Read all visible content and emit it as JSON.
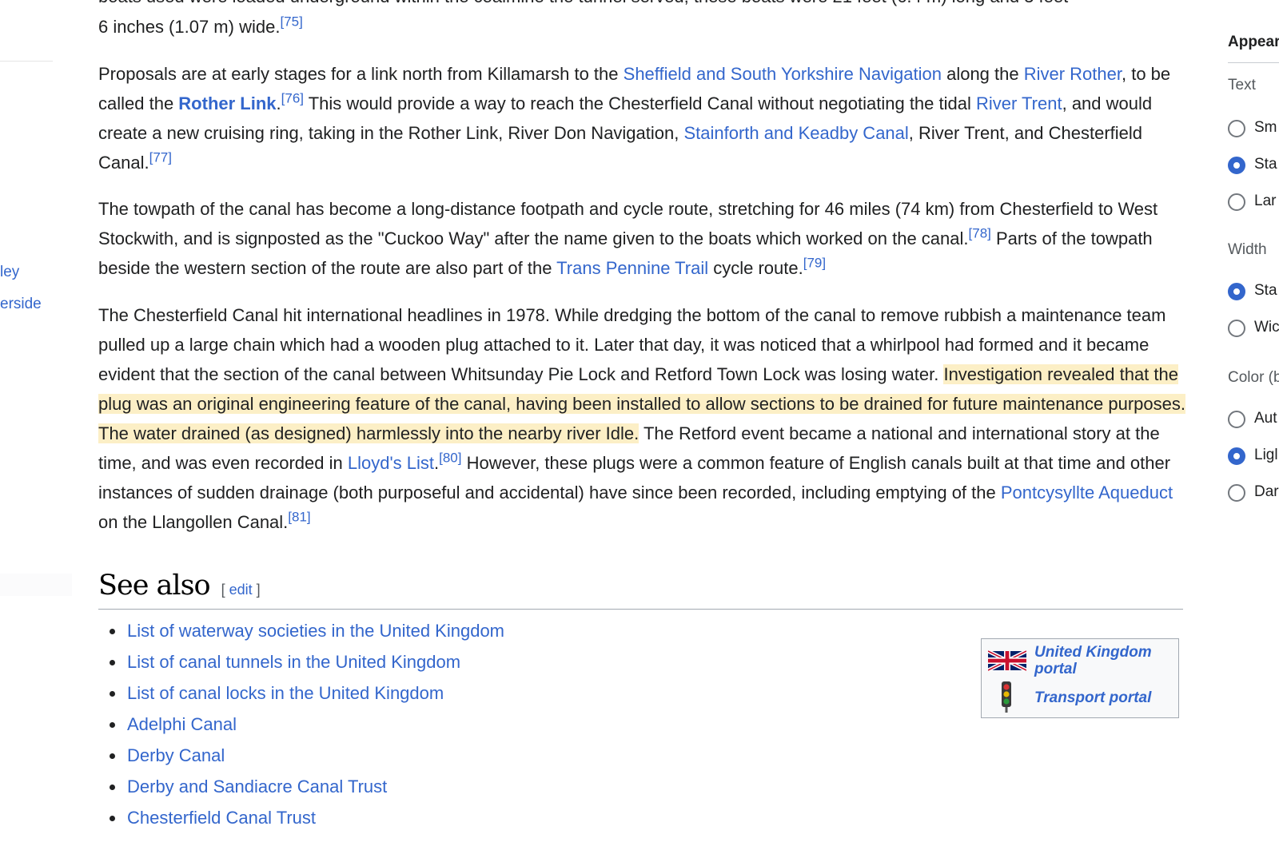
{
  "sidebar": {
    "items": [
      {
        "label": "ley"
      },
      {
        "label": "erside"
      }
    ]
  },
  "article": {
    "top_fragment": {
      "text": "6 inches (1.07 m) wide.",
      "ref": "[75]",
      "clipped_line": "boats used were loaded underground within the coalmine the tunnel served; these boats were 21 feet (6.4 m) long and 3 feet"
    },
    "p1": {
      "t1": "Proposals are at early stages for a link north from Killamarsh to the ",
      "link1": "Sheffield and South Yorkshire Navigation",
      "t2": " along the ",
      "link2": "River Rother",
      "t3": ", to be called the ",
      "link3": "Rother Link",
      "t4": ".",
      "ref1": "[76]",
      "t5": " This would provide a way to reach the Chesterfield Canal without negotiating the tidal ",
      "link4": "River Trent",
      "t6": ", and would create a new cruising ring, taking in the Rother Link, River Don Navigation, ",
      "link5": "Stainforth and Keadby Canal",
      "t7": ", River Trent, and Chesterfield Canal.",
      "ref2": "[77]"
    },
    "p2": {
      "t1": "The towpath of the canal has become a long-distance footpath and cycle route, stretching for 46 miles (74 km) from Chesterfield to West Stockwith, and is signposted as the \"Cuckoo Way\" after the name given to the boats which worked on the canal.",
      "ref1": "[78]",
      "t2": " Parts of the towpath beside the western section of the route are also part of the ",
      "link1": "Trans Pennine Trail",
      "t3": " cycle route.",
      "ref2": "[79]"
    },
    "p3": {
      "t1": "The Chesterfield Canal hit international headlines in 1978. While dredging the bottom of the canal to remove rubbish a maintenance team pulled up a large chain which had a wooden plug attached to it. Later that day, it was noticed that a whirlpool had formed and it became evident that the section of the canal between Whitsunday Pie Lock and Retford Town Lock was losing water. ",
      "highlight": "Investigation revealed that the plug was an original engineering feature of the canal, having been installed to allow sections to be drained for future maintenance purposes. The water drained (as designed) harmlessly into the nearby river Idle.",
      "t2": " The Retford event became a national and international story at the time, and was even recorded in ",
      "link1": "Lloyd's List",
      "t3": ".",
      "ref1": "[80]",
      "t4": " However, these plugs were a common feature of English canals built at that time and other instances of sudden drainage (both purposeful and accidental) have since been recorded, including emptying of the ",
      "link2": "Pontcysyllte Aqueduct",
      "t5": " on the Llangollen Canal.",
      "ref2": "[81]"
    },
    "see_also": {
      "title": "See also",
      "edit_open": "[ ",
      "edit_label": "edit",
      "edit_close": " ]",
      "items": [
        "List of waterway societies in the United Kingdom",
        "List of canal tunnels in the United Kingdom",
        "List of canal locks in the United Kingdom",
        "Adelphi Canal",
        "Derby Canal",
        "Derby and Sandiacre Canal Trust",
        "Chesterfield Canal Trust"
      ]
    },
    "portals": {
      "uk_line1": "United Kingdom",
      "uk_line2": "portal",
      "uk_icon": "uk-flag-icon",
      "transport": "Transport portal",
      "transport_icon": "traffic-light-icon"
    }
  },
  "appearance": {
    "title": "Appear",
    "groups": {
      "text": "Text",
      "width": "Width",
      "color": "Color (b"
    },
    "text_options": [
      {
        "label": "Sm",
        "checked": false
      },
      {
        "label": "Sta",
        "checked": true
      },
      {
        "label": "Lar",
        "checked": false
      }
    ],
    "width_options": [
      {
        "label": "Sta",
        "checked": true
      },
      {
        "label": "Wic",
        "checked": false
      }
    ],
    "color_options": [
      {
        "label": "Aut",
        "checked": false
      },
      {
        "label": "Ligl",
        "checked": true
      },
      {
        "label": "Dar",
        "checked": false
      }
    ]
  },
  "colors": {
    "link": "#3366cc",
    "highlight": "#fcefc6",
    "text": "#202122"
  }
}
